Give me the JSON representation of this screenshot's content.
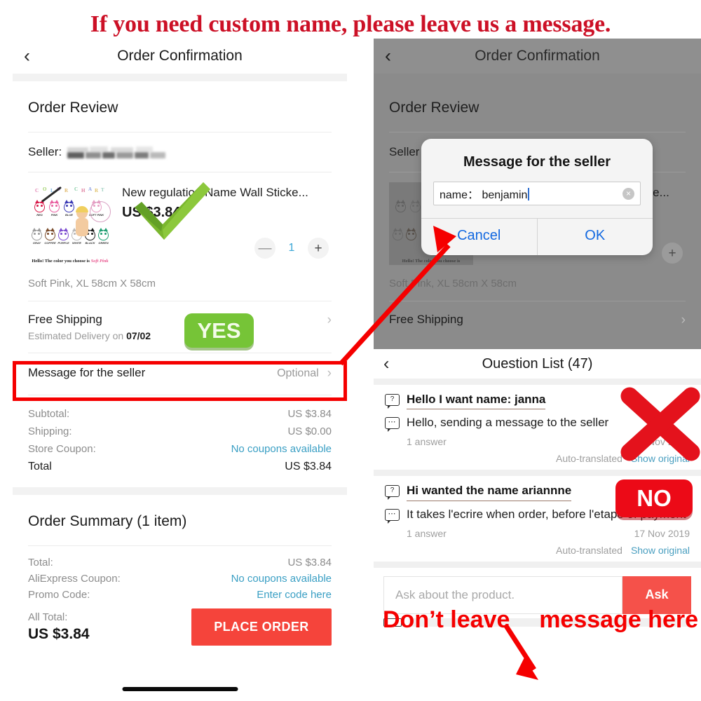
{
  "headline": "If you need custom name, please leave us a message.",
  "left_panel": {
    "navbar": {
      "back_icon": "chevron-left-icon",
      "title": "Order Confirmation"
    },
    "order_review_title": "Order Review",
    "seller_label": "Seller:",
    "product": {
      "name": "New regulation Name Wall Sticke...",
      "price": "US $3.84",
      "variant": "Soft Pink, XL 58cm X 58cm",
      "quantity": "1",
      "minus_label": "—",
      "plus_label": "+",
      "thumb_caption_prefix": "Hello! The color you choose is ",
      "thumb_caption_color": "Soft Pink",
      "thumb_chart_title": "COLOR CHART",
      "thumb_colors_row1": [
        "RED",
        "PINK",
        "BLUE",
        "SOFT PINK"
      ],
      "thumb_colors_row2": [
        "GRAY",
        "COFFEE",
        "PURPLE",
        "WHITE",
        "BLACK",
        "GREEN"
      ]
    },
    "shipping": {
      "title": "Free Shipping",
      "subtitle_prefix": "Estimated Delivery on ",
      "subtitle_date": "07/02"
    },
    "message_row": {
      "label": "Message for the seller",
      "value": "Optional"
    },
    "totals": [
      {
        "key": "Subtotal:",
        "value": "US $3.84",
        "link": false
      },
      {
        "key": "Shipping:",
        "value": "US $0.00",
        "link": false
      },
      {
        "key": "Store Coupon:",
        "value": "No coupons available",
        "link": true
      },
      {
        "key": "Total",
        "value": "US $3.84",
        "link": false,
        "strong": true
      }
    ],
    "summary": {
      "title": "Order Summary (1 item)",
      "rows": [
        {
          "key": "Total:",
          "value": "US $3.84",
          "link": false
        },
        {
          "key": "AliExpress Coupon:",
          "value": "No coupons available",
          "link": true
        },
        {
          "key": "Promo Code:",
          "value": "Enter code here",
          "link": true
        }
      ],
      "all_total_label": "All Total:",
      "all_total_value": "US $3.84",
      "place_order_label": "PLACE ORDER"
    }
  },
  "right_panel": {
    "navbar": {
      "back_icon": "chevron-left-icon",
      "title": "Order Confirmation"
    },
    "order_review_title": "Order Review",
    "seller_label": "Seller",
    "product": {
      "name": "New regulation Name Wall Sticke...",
      "variant": "Soft Pink, XL 58cm X 58cm",
      "plus_label": "+"
    },
    "shipping_title": "Free Shipping",
    "modal": {
      "title": "Message for the seller",
      "input_value": "name： benjamin",
      "clear_icon": "×",
      "cancel_label": "Cancel",
      "ok_label": "OK"
    },
    "question_list": {
      "navbar": {
        "back_icon": "chevron-left-icon",
        "title": "Ouestion List (47)"
      },
      "items": [
        {
          "question": "Hello I want name: janna",
          "answer": "Hello, sending a message to the seller",
          "answers_count": "1 answer",
          "date": "17 Nov 2019",
          "auto_translated": "Auto-translated",
          "show_original": "Show original"
        },
        {
          "question": "Hi wanted the name ariannne",
          "answer": "It takes l'ecrire when order, before l'etape of payment",
          "answers_count": "1 answer",
          "date": "17 Nov 2019",
          "auto_translated": "Auto-translated",
          "show_original": "Show original"
        }
      ],
      "ask_placeholder": "Ask about the product.",
      "ask_button_label": "Ask"
    }
  },
  "annotations": {
    "yes_badge": "YES",
    "no_badge": "NO",
    "dont_leave_left": "Don’t leave",
    "dont_leave_right": "message here"
  },
  "colors": {
    "headline_red": "#cc1026",
    "annotation_red": "#f50000",
    "yes_green": "#76c437",
    "no_red": "#ec0a17",
    "place_order_red": "#f5443b",
    "ask_red": "#f5514a",
    "link_blue": "#3a9fc4",
    "dialog_blue": "#1268e0",
    "check_green": "#7ab62e"
  }
}
